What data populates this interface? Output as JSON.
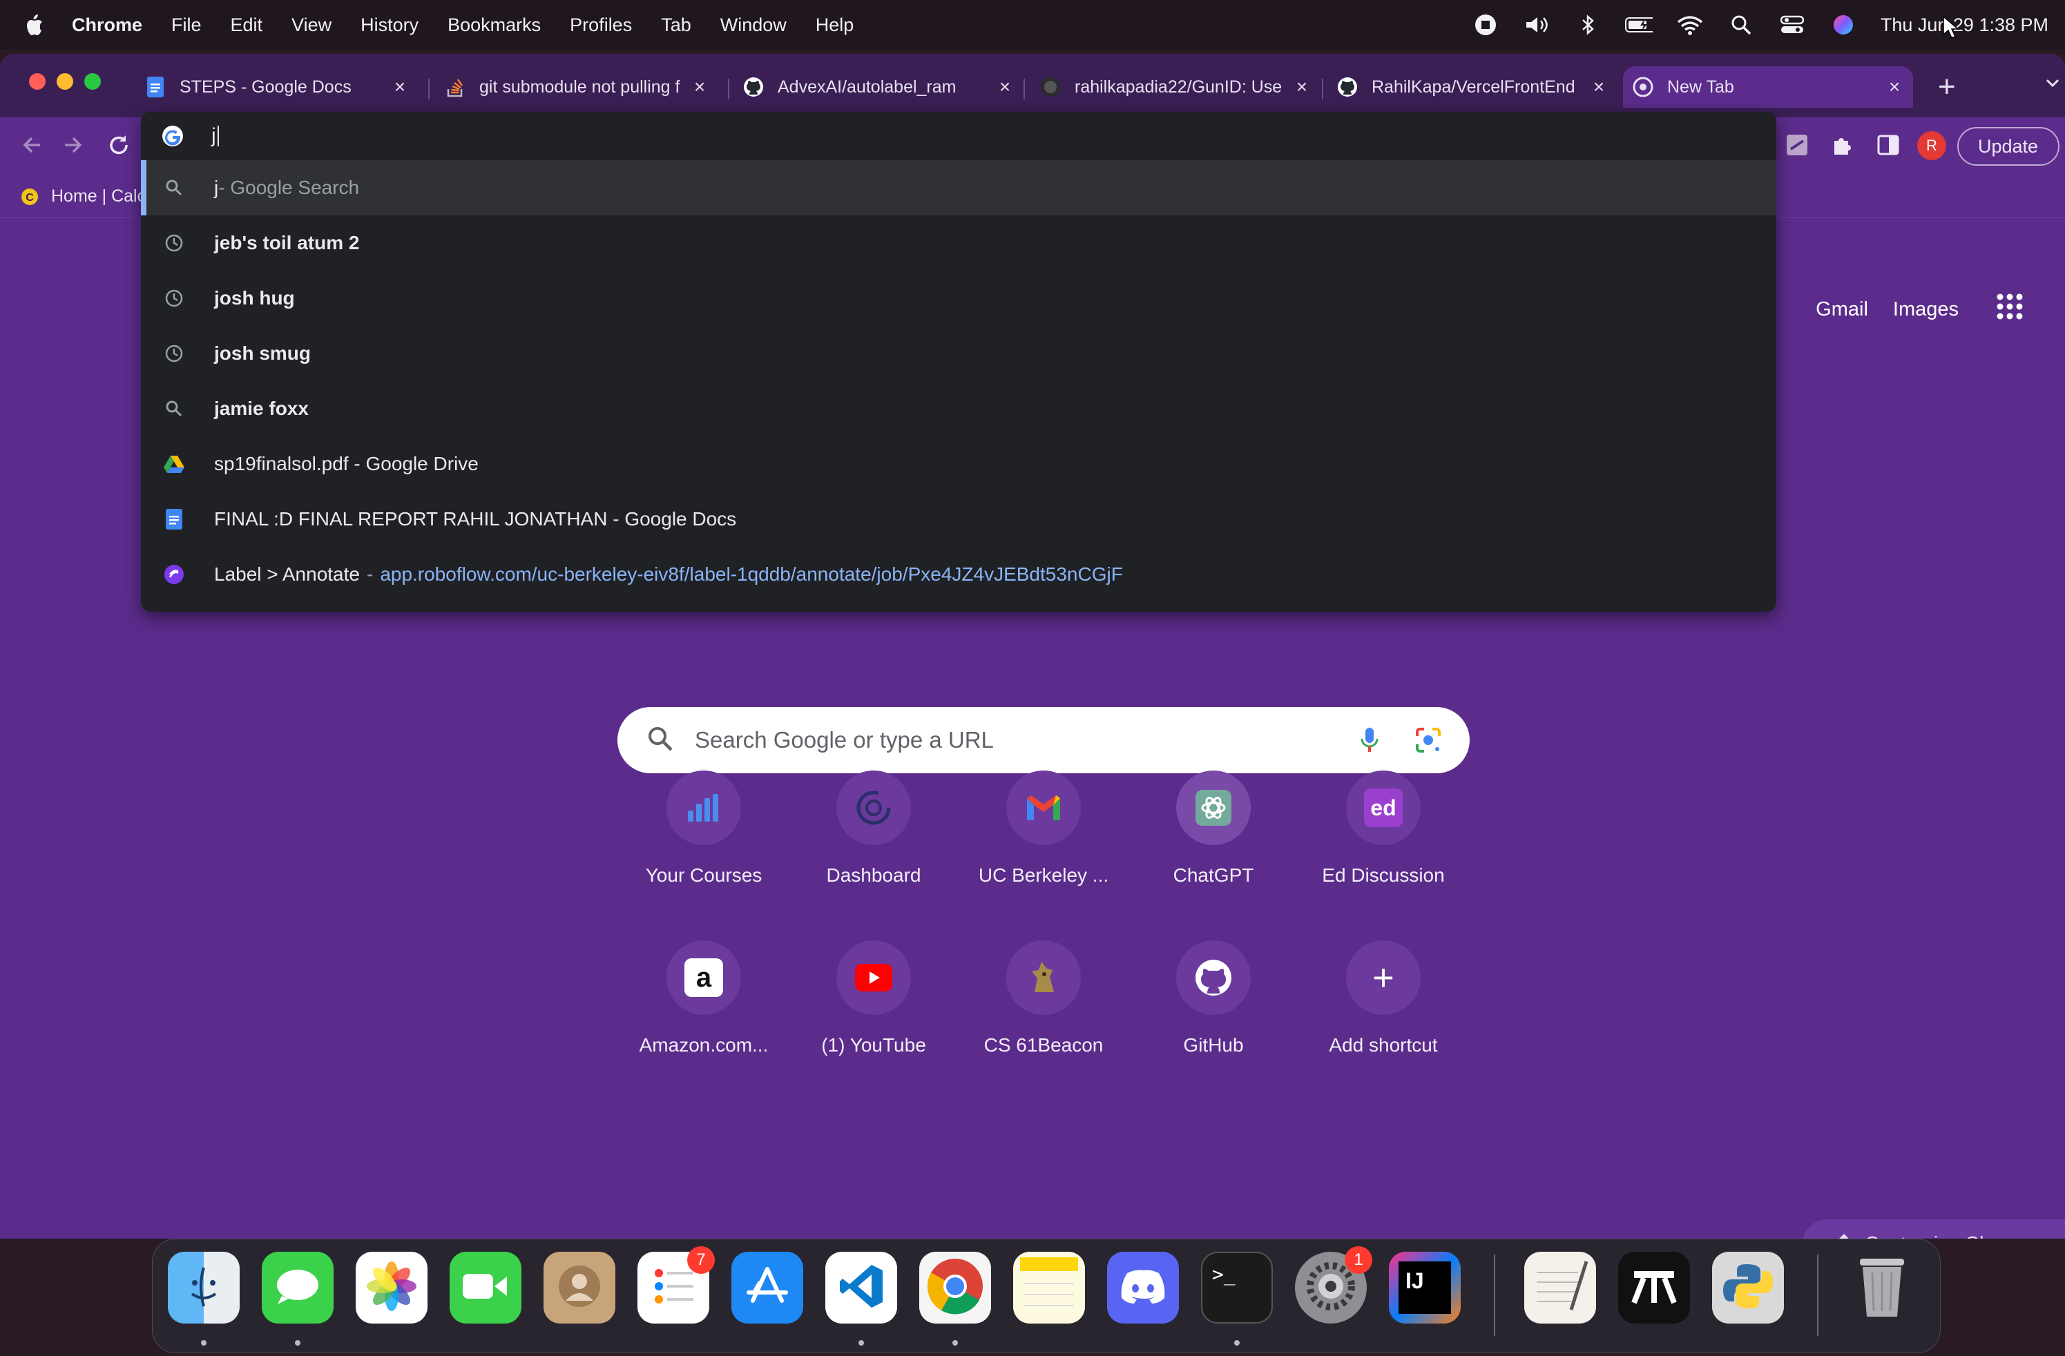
{
  "menubar": {
    "app_name": "Chrome",
    "items": [
      "File",
      "Edit",
      "View",
      "History",
      "Bookmarks",
      "Profiles",
      "Tab",
      "Window",
      "Help"
    ],
    "clock": "Thu Jun 29  1:38 PM"
  },
  "tabs": [
    {
      "title": "STEPS - Google Docs",
      "icon": "google-docs-icon"
    },
    {
      "title": "git submodule not pulling f",
      "icon": "stackoverflow-icon"
    },
    {
      "title": "AdvexAI/autolabel_ram",
      "icon": "github-icon"
    },
    {
      "title": "rahilkapadia22/GunID: Use",
      "icon": "github-icon"
    },
    {
      "title": "RahilKapa/VercelFrontEnd",
      "icon": "github-icon"
    },
    {
      "title": "New Tab",
      "icon": "chrome-icon",
      "active": true
    }
  ],
  "toolbar": {
    "update_label": "Update",
    "profile_initial": "R"
  },
  "bookmarks": {
    "first_label": "Home | Calc"
  },
  "omnibox": {
    "value": "j",
    "suggestions": [
      {
        "icon": "search-icon",
        "bold": "j",
        "rest": " - Google Search",
        "type": "search"
      },
      {
        "icon": "history-icon",
        "bold": "jeb's toil atum 2",
        "rest": "",
        "type": "history"
      },
      {
        "icon": "history-icon",
        "bold": "josh hug",
        "rest": "",
        "type": "history"
      },
      {
        "icon": "history-icon",
        "bold": "josh smug",
        "rest": "",
        "type": "history"
      },
      {
        "icon": "search-icon",
        "bold": "jamie foxx",
        "rest": "",
        "type": "search"
      },
      {
        "icon": "google-drive-icon",
        "text": "sp19finalsol.pdf - Google Drive",
        "type": "drive"
      },
      {
        "icon": "google-docs-icon",
        "text": "FINAL :D FINAL REPORT RAHIL JONATHAN - Google Docs",
        "type": "docs"
      },
      {
        "icon": "roboflow-icon",
        "text": "Label > Annotate",
        "url": "app.roboflow.com/uc-berkeley-eiv8f/label-1qddb/annotate/job/Pxe4JZ4vJEBdt53nCGjF",
        "type": "url"
      }
    ]
  },
  "page": {
    "search_placeholder": "Search Google or type a URL",
    "top_links": [
      "Gmail",
      "Images"
    ],
    "customize_label": "Customize Chrome",
    "shortcuts": [
      {
        "label": "Your Courses",
        "icon": "bar-chart-icon"
      },
      {
        "label": "Dashboard",
        "icon": "canvas-icon"
      },
      {
        "label": "UC Berkeley ...",
        "icon": "gmail-icon"
      },
      {
        "label": "ChatGPT",
        "icon": "openai-icon"
      },
      {
        "label": "Ed Discussion",
        "icon": "ed-icon",
        "glyph": "ed"
      },
      {
        "label": "Amazon.com...",
        "icon": "amazon-icon",
        "glyph": "a"
      },
      {
        "label": "(1) YouTube",
        "icon": "youtube-icon"
      },
      {
        "label": "CS 61Beacon",
        "icon": "beacon-icon"
      },
      {
        "label": "GitHub",
        "icon": "github-icon"
      },
      {
        "label": "Add shortcut",
        "icon": "plus-icon",
        "glyph": "+"
      }
    ]
  },
  "dock": {
    "apps": [
      {
        "name": "Finder",
        "icon": "finder-icon"
      },
      {
        "name": "Messages",
        "icon": "messages-icon"
      },
      {
        "name": "Photos",
        "icon": "photos-icon"
      },
      {
        "name": "FaceTime",
        "icon": "facetime-icon"
      },
      {
        "name": "Contacts",
        "icon": "contacts-icon"
      },
      {
        "name": "Reminders",
        "icon": "reminders-icon",
        "badge": "7"
      },
      {
        "name": "App Store",
        "icon": "app-store-icon"
      },
      {
        "name": "VS Code",
        "icon": "vscode-icon"
      },
      {
        "name": "Chrome",
        "icon": "chrome-icon"
      },
      {
        "name": "Notes",
        "icon": "notes-icon"
      },
      {
        "name": "Discord",
        "icon": "discord-icon"
      },
      {
        "name": "Terminal",
        "icon": "terminal-icon",
        "glyph": ">_"
      },
      {
        "name": "System Settings",
        "icon": "settings-icon",
        "badge": "1"
      },
      {
        "name": "IntelliJ IDEA",
        "icon": "intellij-icon",
        "glyph": "IJ"
      },
      {
        "name": "TextEdit",
        "icon": "textedit-icon"
      },
      {
        "name": "Final Cut",
        "icon": "clapper-icon"
      },
      {
        "name": "Python Launcher",
        "icon": "python-icon"
      },
      {
        "name": "Trash",
        "icon": "trash-icon"
      }
    ]
  },
  "colors": {
    "page_bg": "#5b2c8b",
    "omnibox_bg": "#202124",
    "link_blue": "#8ab4f8",
    "badge_red": "#ff3b30"
  }
}
